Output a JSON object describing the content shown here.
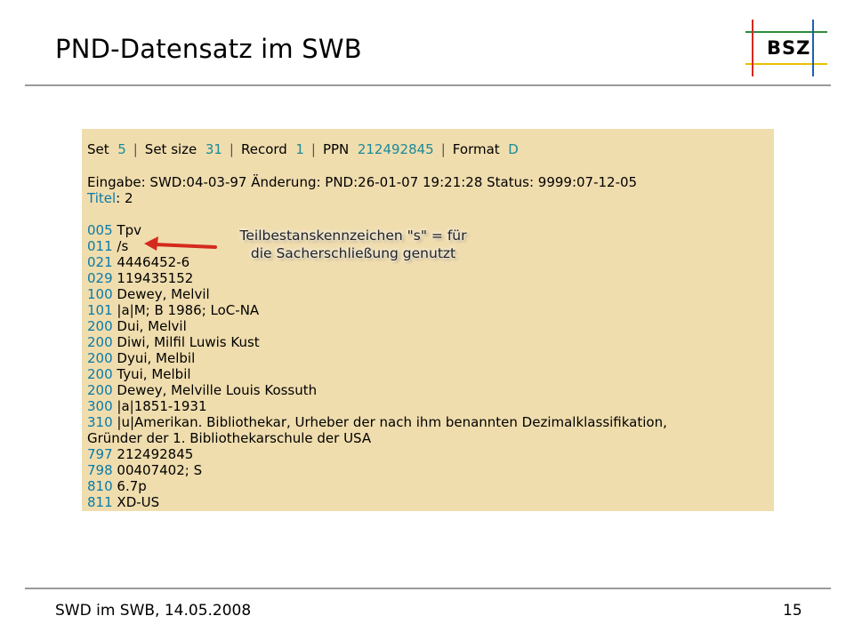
{
  "slide": {
    "title": "PND-Datensatz im SWB",
    "logo_text": "BSZ",
    "footer_left": "SWD im SWB, 14.05.2008",
    "page_number": "15"
  },
  "header": {
    "set_label": "Set",
    "set_value": "5",
    "setsize_label": "Set size",
    "setsize_value": "31",
    "record_label": "Record",
    "record_value": "1",
    "ppn_label": "PPN",
    "ppn_value": "212492845",
    "format_label": "Format",
    "format_value": "D"
  },
  "meta": {
    "line": "Eingabe: SWD:04-03-97 Änderung: PND:26-01-07 19:21:28 Status: 9999:07-12-05",
    "titel_label": "Titel",
    "titel_value": "2"
  },
  "fields": [
    {
      "tag": "005",
      "value": "Tpv"
    },
    {
      "tag": "011",
      "value": "/s"
    },
    {
      "tag": "021",
      "value": "4446452-6"
    },
    {
      "tag": "029",
      "value": "119435152"
    },
    {
      "tag": "100",
      "value": "Dewey, Melvil"
    },
    {
      "tag": "101",
      "value": "|a|M; B 1986; LoC-NA"
    },
    {
      "tag": "200",
      "value": "Dui, Melvil"
    },
    {
      "tag": "200",
      "value": "Diwi, Milfil Luwis Kust"
    },
    {
      "tag": "200",
      "value": "Dyui, Melbil"
    },
    {
      "tag": "200",
      "value": "Tyui, Melbil"
    },
    {
      "tag": "200",
      "value": "Dewey, Melville Louis Kossuth"
    },
    {
      "tag": "300",
      "value": "|a|1851-1931"
    },
    {
      "tag": "310",
      "value": "|u|Amerikan. Bibliothekar, Urheber der nach ihm benannten Dezimalklassifikation,"
    },
    {
      "tag": "",
      "value": "Gründer der 1. Bibliothekarschule der USA"
    },
    {
      "tag": "797",
      "value": "212492845"
    },
    {
      "tag": "798",
      "value": "00407402; S"
    },
    {
      "tag": "810",
      "value": "6.7p"
    },
    {
      "tag": "811",
      "value": "XD-US"
    }
  ],
  "callout": {
    "line1": "Teilbestanskennzeichen \"s\" = für",
    "line2": "die Sacherschließung genutzt"
  },
  "colors": {
    "record_bg": "#f0ddae",
    "tag_blue": "#0a7aa8",
    "arrow_red": "#d42a1e"
  }
}
